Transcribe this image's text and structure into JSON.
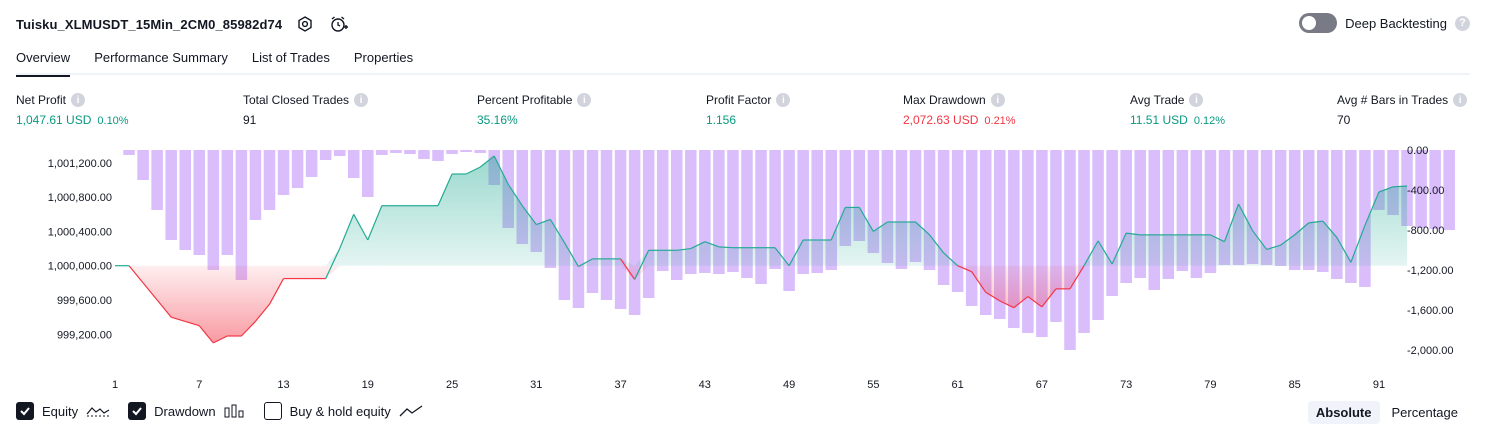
{
  "header": {
    "strategy_title": "Tuisku_XLMUSDT_15Min_2CM0_85982d74",
    "deep_backtesting_label": "Deep Backtesting",
    "deep_backtesting_on": false,
    "help_glyph": "?"
  },
  "tabs": [
    {
      "label": "Overview",
      "active": true
    },
    {
      "label": "Performance Summary",
      "active": false
    },
    {
      "label": "List of Trades",
      "active": false
    },
    {
      "label": "Properties",
      "active": false
    }
  ],
  "metrics": [
    {
      "label": "Net Profit",
      "value": "1,047.61 USD",
      "pct": "0.10%",
      "tone": "green"
    },
    {
      "label": "Total Closed Trades",
      "value": "91",
      "pct": "",
      "tone": "dark"
    },
    {
      "label": "Percent Profitable",
      "value": "35.16%",
      "pct": "",
      "tone": "green"
    },
    {
      "label": "Profit Factor",
      "value": "1.156",
      "pct": "",
      "tone": "green"
    },
    {
      "label": "Max Drawdown",
      "value": "2,072.63 USD",
      "pct": "0.21%",
      "tone": "red"
    },
    {
      "label": "Avg Trade",
      "value": "11.51 USD",
      "pct": "0.12%",
      "tone": "green"
    },
    {
      "label": "Avg # Bars in Trades",
      "value": "70",
      "pct": "",
      "tone": "dark"
    }
  ],
  "chart_data": {
    "type": "line",
    "equity_axis_labels": [
      "1,001,200.00",
      "1,000,800.00",
      "1,000,400.00",
      "1,000,000.00",
      "999,600.00",
      "999,200.00"
    ],
    "equity_axis_values": [
      1001200,
      1000800,
      1000400,
      1000000,
      999600,
      999200
    ],
    "equity_baseline": 1000000,
    "equity_ylim": [
      998900,
      1001350
    ],
    "drawdown_axis_labels": [
      "0.00",
      "-400.00",
      "-800.00",
      "-1,200.00",
      "-1,600.00",
      "-2,000.00"
    ],
    "drawdown_axis_values": [
      0,
      -400,
      -800,
      -1200,
      -1600,
      -2000
    ],
    "drawdown_ylim": [
      -2100,
      0
    ],
    "x_tick_labels": [
      "1",
      "7",
      "13",
      "19",
      "25",
      "31",
      "37",
      "43",
      "49",
      "55",
      "61",
      "67",
      "73",
      "79",
      "85",
      "91"
    ],
    "x_tick_values": [
      1,
      7,
      13,
      19,
      25,
      31,
      37,
      43,
      49,
      55,
      61,
      67,
      73,
      79,
      85,
      91
    ],
    "trades_range": [
      1,
      92
    ],
    "equity": [
      1000000,
      1000000,
      999800,
      999600,
      999400,
      999350,
      999300,
      999100,
      999180,
      999180,
      999350,
      999550,
      999850,
      999850,
      999850,
      999850,
      1000200,
      1000600,
      1000300,
      1000700,
      1000700,
      1000700,
      1000700,
      1000700,
      1001070,
      1001070,
      1001150,
      1001280,
      1000950,
      1000700,
      1000480,
      1000540,
      1000270,
      999990,
      1000080,
      1000080,
      1000080,
      999840,
      1000180,
      1000180,
      1000180,
      1000200,
      1000280,
      1000220,
      1000210,
      1000210,
      1000210,
      1000210,
      1000000,
      1000300,
      1000300,
      1000300,
      1000680,
      1000680,
      1000400,
      1000510,
      1000510,
      1000510,
      1000360,
      1000150,
      1000000,
      999930,
      999690,
      999590,
      999510,
      999640,
      999520,
      999730,
      999730,
      1000000,
      1000290,
      1000020,
      1000380,
      1000360,
      1000360,
      1000360,
      1000360,
      1000360,
      1000360,
      1000280,
      1000720,
      1000410,
      1000190,
      1000240,
      1000360,
      1000500,
      1000520,
      1000330,
      1000040,
      1000470,
      1000860,
      1000920,
      1000930
    ],
    "drawdown_bars": [
      0,
      -50,
      -300,
      -600,
      -900,
      -1000,
      -1050,
      -1200,
      -1050,
      -1300,
      -700,
      -600,
      -450,
      -380,
      -270,
      -100,
      -60,
      -280,
      -470,
      -50,
      -30,
      -40,
      -90,
      -110,
      -40,
      -20,
      -30,
      -350,
      -780,
      -940,
      -1020,
      -1180,
      -1500,
      -1580,
      -1430,
      -1500,
      -1590,
      -1650,
      -1480,
      -1210,
      -1300,
      -1240,
      -1230,
      -1240,
      -1220,
      -1280,
      -1340,
      -1190,
      -1410,
      -1240,
      -1230,
      -1200,
      -960,
      -910,
      -1030,
      -1130,
      -1190,
      -1120,
      -1200,
      -1350,
      -1420,
      -1560,
      -1650,
      -1690,
      -1780,
      -1830,
      -1870,
      -1720,
      -2000,
      -1830,
      -1700,
      -1460,
      -1330,
      -1280,
      -1400,
      -1290,
      -1210,
      -1280,
      -1230,
      -1150,
      -1150,
      -1140,
      -1150,
      -1160,
      -1200,
      -1200,
      -1220,
      -1290,
      -1330,
      -1370,
      -600,
      -650,
      -760,
      -780,
      -790,
      -800
    ]
  },
  "legend": [
    {
      "label": "Equity",
      "checked": true,
      "icon": "equity-line-icon"
    },
    {
      "label": "Drawdown",
      "checked": true,
      "icon": "drawdown-bars-icon"
    },
    {
      "label": "Buy & hold equity",
      "checked": false,
      "icon": "buy-hold-line-icon"
    }
  ],
  "modes": [
    {
      "label": "Absolute",
      "active": true
    },
    {
      "label": "Percentage",
      "active": false
    }
  ]
}
